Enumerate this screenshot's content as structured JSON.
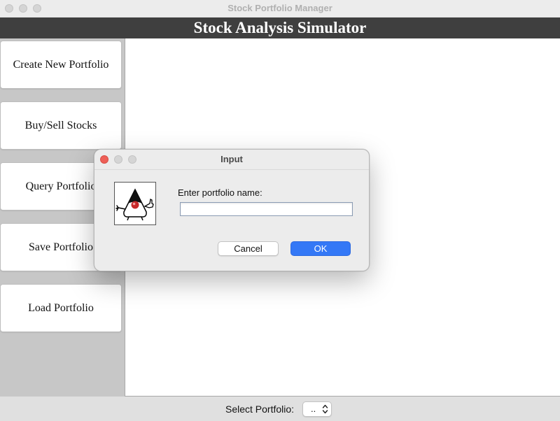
{
  "window": {
    "title": "Stock Portfolio Manager"
  },
  "header": {
    "title": "Stock Analysis Simulator"
  },
  "sidebar": {
    "items": [
      {
        "label": "Create New Portfolio"
      },
      {
        "label": "Buy/Sell Stocks"
      },
      {
        "label": "Query Portfolio"
      },
      {
        "label": "Save Portfolio"
      },
      {
        "label": "Load Portfolio"
      }
    ]
  },
  "footer": {
    "select_label": "Select Portfolio:",
    "select_value": ".."
  },
  "dialog": {
    "title": "Input",
    "prompt": "Enter portfolio name:",
    "input_value": "",
    "cancel_label": "Cancel",
    "ok_label": "OK",
    "icon": "java-duke-icon"
  },
  "colors": {
    "banner_bg": "#3f3f3f",
    "ok_button": "#3478f6",
    "close_dot": "#ee5f57",
    "sidebar_bg": "#c7c7c7"
  }
}
